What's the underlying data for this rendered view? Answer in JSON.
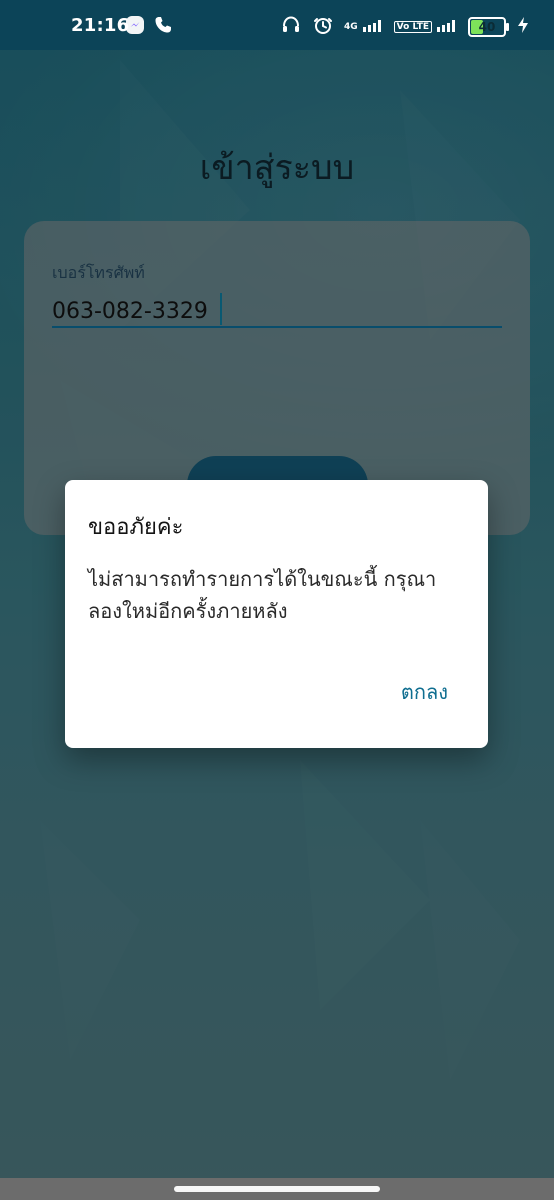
{
  "status_bar": {
    "time": "21:16",
    "network_4g_label": "4G",
    "volte_label": "Vo LTE",
    "battery_level": 40,
    "battery_text": "40"
  },
  "screen": {
    "title": "เข้าสู่ระบบ",
    "phone_label": "เบอร์โทรศัพท์",
    "phone_value": "063-082-3329",
    "primary_button_label": ""
  },
  "dialog": {
    "title": "ขออภัยค่ะ",
    "message": "ไม่สามารถทำรายการได้ในขณะนี้ กรุณาลองใหม่อีกครั้งภายหลัง",
    "ok_label": "ตกลง"
  },
  "icons": {
    "messenger": "messenger-icon",
    "phone": "phone-icon",
    "headset": "headset-icon",
    "alarm": "alarm-icon",
    "signal": "signal-icon",
    "charging": "charging-bolt-icon"
  },
  "colors": {
    "statusbar": "#0c4458",
    "accent": "#0f6e90",
    "battery_fill": "#7ee35a"
  }
}
